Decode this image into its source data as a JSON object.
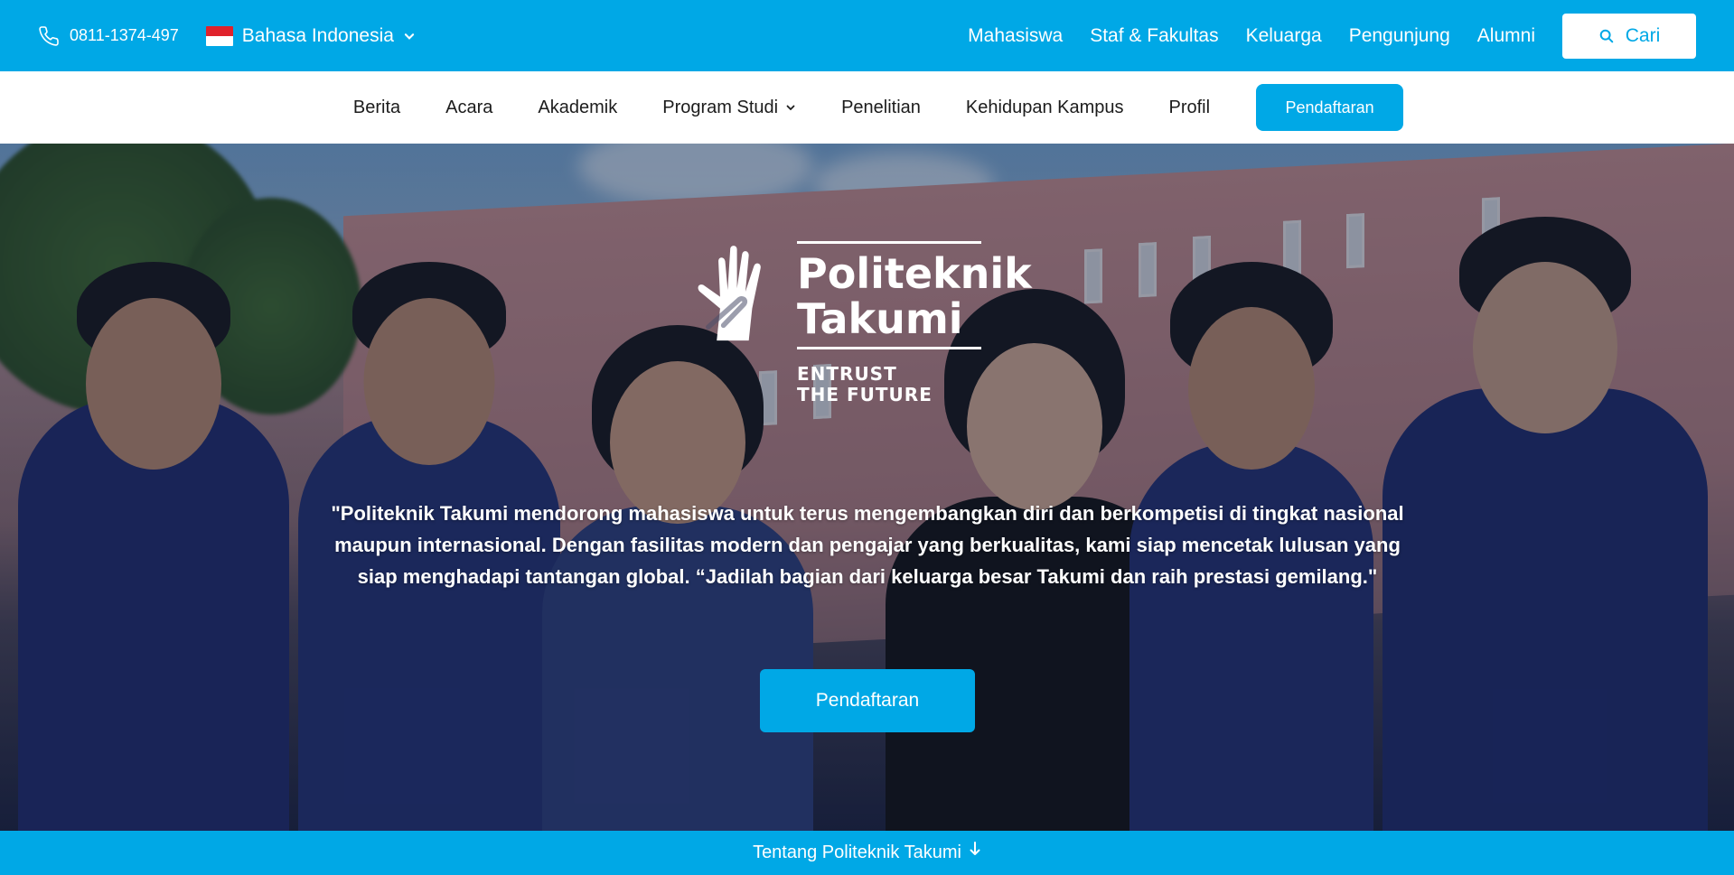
{
  "colors": {
    "brand": "#00a8e6",
    "white": "#ffffff",
    "flag_red": "#e0222b"
  },
  "topbar": {
    "phone_icon": "phone-icon",
    "phone": "0811-1374-497",
    "language": "Bahasa Indonesia",
    "language_flag": "indonesia-flag-icon",
    "links": [
      "Mahasiswa",
      "Staf & Fakultas",
      "Keluarga",
      "Pengunjung",
      "Alumni"
    ],
    "search_label": "Cari"
  },
  "mainnav": {
    "items": [
      "Berita",
      "Acara",
      "Akademik",
      "Program Studi",
      "Penelitian",
      "Kehidupan Kampus",
      "Profil"
    ],
    "register_label": "Pendaftaran"
  },
  "hero": {
    "logo_name_line1": "Politeknik",
    "logo_name_line2": "Takumi",
    "logo_tag_line1": "ENTRUST",
    "logo_tag_line2": "THE FUTURE",
    "quote": "\"Politeknik Takumi mendorong mahasiswa untuk terus mengembangkan diri dan berkompetisi di tingkat nasional maupun internasional. Dengan fasilitas modern dan pengajar yang berkualitas, kami siap mencetak lulusan yang siap menghadapi tantangan global. “Jadilah bagian dari keluarga besar Takumi dan raih prestasi gemilang.\"",
    "cta_label": "Pendaftaran"
  },
  "bottombar": {
    "label": "Tentang Politeknik Takumi",
    "icon": "arrow-down-icon"
  }
}
